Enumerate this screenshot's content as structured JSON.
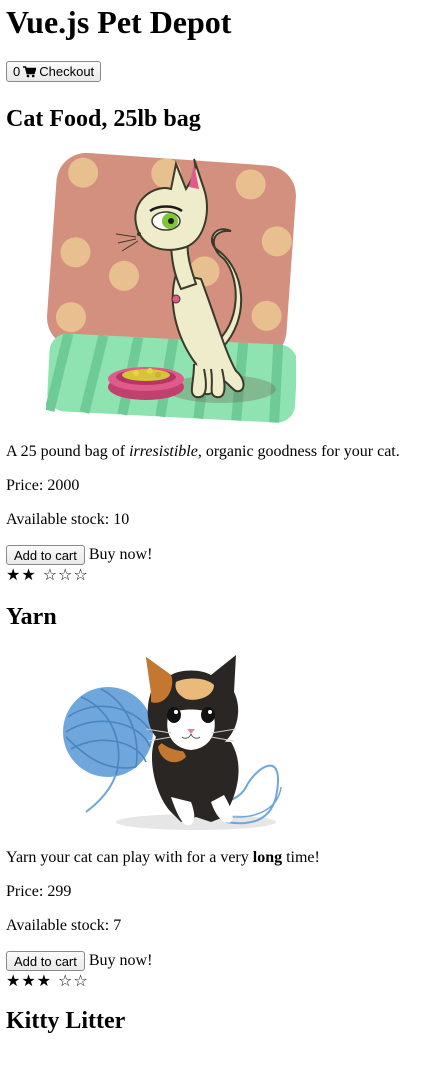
{
  "app": {
    "title": "Vue.js Pet Depot"
  },
  "checkout": {
    "count": "0",
    "label": "Checkout",
    "icon": "cart-icon"
  },
  "products": [
    {
      "title": "Cat Food, 25lb bag",
      "image_alt": "cartoon cat with food bowl",
      "description_pre": "A 25 pound bag of ",
      "description_em": "irresistible",
      "description_post": ", organic goodness for your cat.",
      "price_label": "Price: ",
      "price": "2000",
      "stock_label": "Available stock: ",
      "stock": "10",
      "add_label": "Add to cart",
      "buy_now": "Buy now!",
      "rating": 2,
      "rating_max": 5,
      "stars_filled": "★★",
      "stars_empty": "☆☆☆"
    },
    {
      "title": "Yarn",
      "image_alt": "kitten with ball of yarn",
      "description_pre": "Yarn your cat can play with for a very ",
      "description_strong": "long",
      "description_post": " time!",
      "price_label": "Price: ",
      "price": "299",
      "stock_label": "Available stock: ",
      "stock": "7",
      "add_label": "Add to cart",
      "buy_now": "Buy now!",
      "rating": 3,
      "rating_max": 5,
      "stars_filled": "★★★",
      "stars_empty": "☆☆"
    },
    {
      "title": "Kitty Litter"
    }
  ],
  "colors": {
    "cat_bg_pink": "#d4907f",
    "cat_bg_dots": "#e8c090",
    "cat_mat_green": "#8fe3b0",
    "cat_body": "#eeeccb",
    "cat_eye": "#7fc53a",
    "bowl_pink": "#e05a8c",
    "yarn_blue": "#6fa7dc"
  }
}
